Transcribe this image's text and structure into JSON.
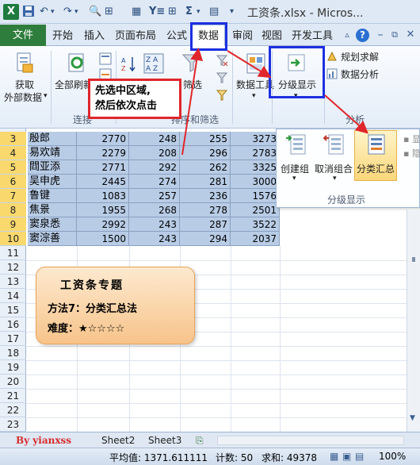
{
  "title_bar": {
    "app_icon": "excel-icon",
    "document_title": "工资条.xlsx - Micros..."
  },
  "tabs": {
    "file": "文件",
    "items": [
      "开始",
      "插入",
      "页面布局",
      "公式",
      "数据",
      "审阅",
      "视图",
      "开发工具"
    ],
    "selected": "数据"
  },
  "ribbon": {
    "get_external_data": "获取\n外部数据",
    "get_external_data_line1": "获取",
    "get_external_data_line2": "外部数据",
    "refresh_all": "全部刷新",
    "connections_group": "连接",
    "sort_filter_group": "排序和筛选",
    "filter": "筛选",
    "data_tools": "数据工具",
    "outline": "分级显示",
    "solver": "规划求解",
    "data_analysis": "数据分析",
    "analysis_group": "分析"
  },
  "callout": {
    "line1": "先选中区域,",
    "line2": "然后依次点击"
  },
  "outline_dropdown": {
    "create_group": "创建组",
    "ungroup": "取消组合",
    "subtotal": "分类汇总",
    "group_label": "分级显示"
  },
  "sheet": {
    "row_numbers": [
      "3",
      "4",
      "5",
      "6",
      "7",
      "8",
      "9",
      "10",
      "11",
      "12",
      "13",
      "14",
      "15",
      "16",
      "17",
      "18",
      "19",
      "20",
      "21",
      "22",
      "23"
    ],
    "rows": [
      {
        "name": "殷郎",
        "c1": "2770",
        "c2": "248",
        "c3": "255",
        "c4": "3273"
      },
      {
        "name": "易欢靖",
        "c1": "2279",
        "c2": "208",
        "c3": "296",
        "c4": "2783"
      },
      {
        "name": "閰亚添",
        "c1": "2771",
        "c2": "292",
        "c3": "262",
        "c4": "3325"
      },
      {
        "name": "吴申虎",
        "c1": "2445",
        "c2": "274",
        "c3": "281",
        "c4": "3000"
      },
      {
        "name": "鲁键",
        "c1": "1083",
        "c2": "257",
        "c3": "236",
        "c4": "1576"
      },
      {
        "name": "焦景",
        "c1": "1955",
        "c2": "268",
        "c3": "278",
        "c4": "2501"
      },
      {
        "name": "窦泉悉",
        "c1": "2992",
        "c2": "243",
        "c3": "287",
        "c4": "3522"
      },
      {
        "name": "窦淙善",
        "c1": "1500",
        "c2": "243",
        "c3": "294",
        "c4": "2037"
      }
    ]
  },
  "infobox": {
    "title": "工资条专题",
    "method": "方法7：分类汇总法",
    "difficulty": "难度：★☆☆☆☆"
  },
  "sheet_tabs": {
    "watermark": "By yianxss",
    "items": [
      "Sheet2",
      "Sheet3"
    ]
  },
  "status_bar": {
    "average": "平均值: 1371.611111",
    "count": "计数: 50",
    "sum": "求和: 49378",
    "zoom": "100%"
  },
  "colors": {
    "file_tab": "#2f7d3d",
    "selection": "#b8cce6",
    "highlight_box": "#1d2fe0",
    "callout_border": "#e0262a",
    "arrow": "#e0262a"
  }
}
